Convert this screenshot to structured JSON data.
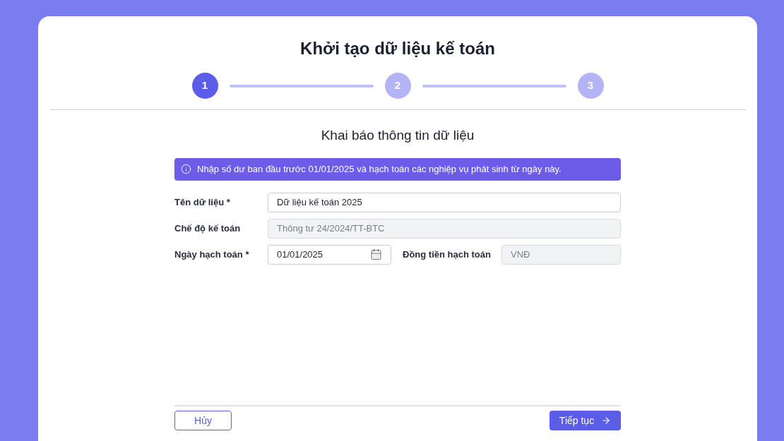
{
  "title": "Khởi tạo dữ liệu kế toán",
  "steps": [
    {
      "label": "1",
      "selected": true
    },
    {
      "label": "2",
      "selected": false
    },
    {
      "label": "3",
      "selected": false
    }
  ],
  "section_title": "Khai báo thông tin dữ liệu",
  "notice": "Nhập số dư ban đầu trước 01/01/2025 và hạch toán các nghiệp vụ phát sinh từ ngày này.",
  "fields": [
    {
      "label": "Tên dữ liệu *",
      "value": "Dữ liệu kế toán 2025",
      "disabled": false
    },
    {
      "label": "Chế độ kế toán",
      "value": "Thông tư 24/2024/TT-BTC",
      "disabled": true
    }
  ],
  "date_field": {
    "label": "Ngày hạch toán *",
    "value": "01/01/2025",
    "disabled": false
  },
  "currency_field": {
    "label": "Đồng tiền hạch toán",
    "value": "VNĐ",
    "disabled": true
  },
  "buttons": {
    "cancel": "Hủy",
    "next": "Tiếp tục"
  }
}
